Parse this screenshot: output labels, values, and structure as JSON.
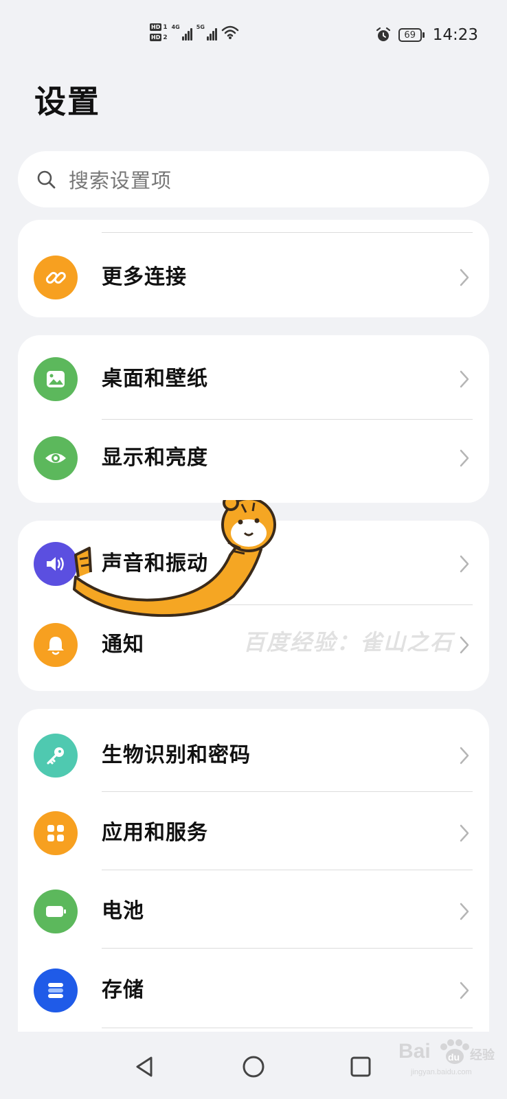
{
  "status_bar": {
    "hd1": "HD",
    "hd1_num": "1",
    "hd2": "HD",
    "hd2_num": "2",
    "net1": "4G",
    "net2": "5G",
    "battery": "69",
    "time": "14:23"
  },
  "page": {
    "title": "设置"
  },
  "search": {
    "placeholder": "搜索设置项"
  },
  "groups": [
    {
      "items": [
        {
          "label": "更多连接",
          "icon": "link-icon",
          "color": "#F7A020"
        }
      ]
    },
    {
      "items": [
        {
          "label": "桌面和壁纸",
          "icon": "wallpaper-icon",
          "color": "#5CB85C"
        },
        {
          "label": "显示和亮度",
          "icon": "eye-icon",
          "color": "#5CB85C"
        }
      ]
    },
    {
      "items": [
        {
          "label": "声音和振动",
          "icon": "speaker-icon",
          "color": "#5B4FE0"
        },
        {
          "label": "通知",
          "icon": "bell-icon",
          "color": "#F7A020"
        }
      ]
    },
    {
      "items": [
        {
          "label": "生物识别和密码",
          "icon": "key-icon",
          "color": "#4FC9B0"
        },
        {
          "label": "应用和服务",
          "icon": "apps-icon",
          "color": "#F7A020"
        },
        {
          "label": "电池",
          "icon": "battery-icon",
          "color": "#5CB85C"
        },
        {
          "label": "存储",
          "icon": "storage-icon",
          "color": "#1F5BE8"
        }
      ]
    }
  ],
  "watermark": {
    "text": "百度经验：雀山之石",
    "logo": "Baidu经验",
    "logo_url": "jingyan.baidu.com"
  },
  "nav": {
    "back": "back-icon",
    "home": "home-icon",
    "recents": "recents-icon"
  }
}
